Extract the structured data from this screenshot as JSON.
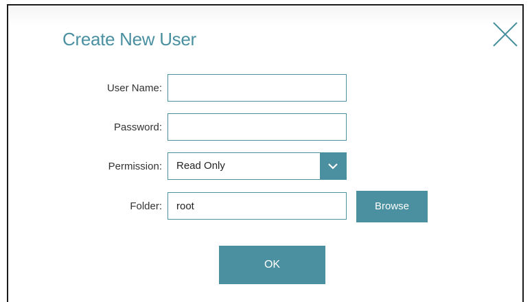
{
  "dialog": {
    "title": "Create New User",
    "close_icon": "close-icon"
  },
  "form": {
    "username": {
      "label": "User Name:",
      "value": ""
    },
    "password": {
      "label": "Password:",
      "value": ""
    },
    "permission": {
      "label": "Permission:",
      "selected": "Read Only",
      "icon": "chevron-down-icon"
    },
    "folder": {
      "label": "Folder:",
      "value": "root",
      "browse_label": "Browse"
    }
  },
  "actions": {
    "ok_label": "OK"
  },
  "colors": {
    "accent": "#4a90a0",
    "title": "#4a90a0",
    "label": "#333333"
  }
}
